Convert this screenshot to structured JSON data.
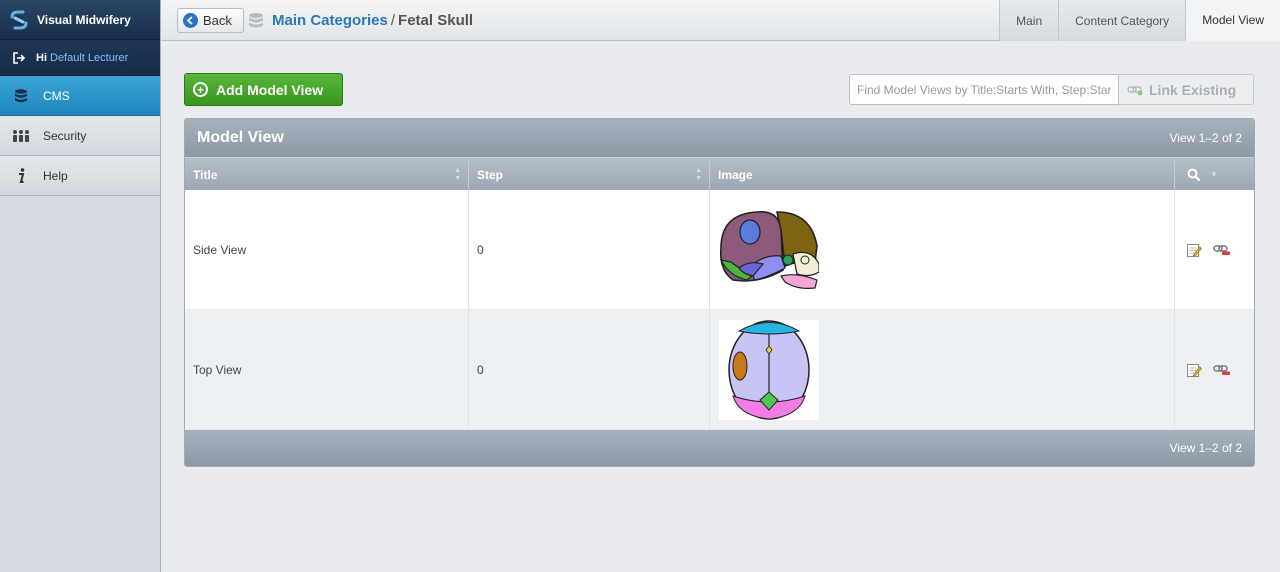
{
  "sidebar": {
    "brand": "Visual Midwifery",
    "greeting": "Hi",
    "user": "Default Lecturer",
    "items": [
      {
        "label": "CMS",
        "icon": "database-icon",
        "active": true
      },
      {
        "label": "Security",
        "icon": "users-icon",
        "active": false
      },
      {
        "label": "Help",
        "icon": "info-icon",
        "active": false
      }
    ]
  },
  "topbar": {
    "back_label": "Back",
    "breadcrumb_link": "Main Categories",
    "breadcrumb_sep": "/",
    "breadcrumb_current": "Fetal Skull",
    "tabs": [
      "Main",
      "Content Category",
      "Model View"
    ],
    "active_tab": "Model View"
  },
  "actions": {
    "add_label": "Add Model View",
    "search_placeholder": "Find Model Views by Title:Starts With, Step:Starts With",
    "link_label": "Link Existing"
  },
  "grid": {
    "title": "Model View",
    "count_text": "View 1–2 of 2",
    "columns": [
      "Title",
      "Step",
      "Image"
    ],
    "rows": [
      {
        "title": "Side View",
        "step": "0",
        "image": "fetal-skull-side-view"
      },
      {
        "title": "Top View",
        "step": "0",
        "image": "fetal-skull-top-view"
      }
    ],
    "footer_text": "View 1–2 of 2"
  },
  "colors": {
    "accent": "#1f86bd",
    "add_button": "#3a951f",
    "brand_bg": "#1a2f4c",
    "link": "#2a7ab8"
  }
}
